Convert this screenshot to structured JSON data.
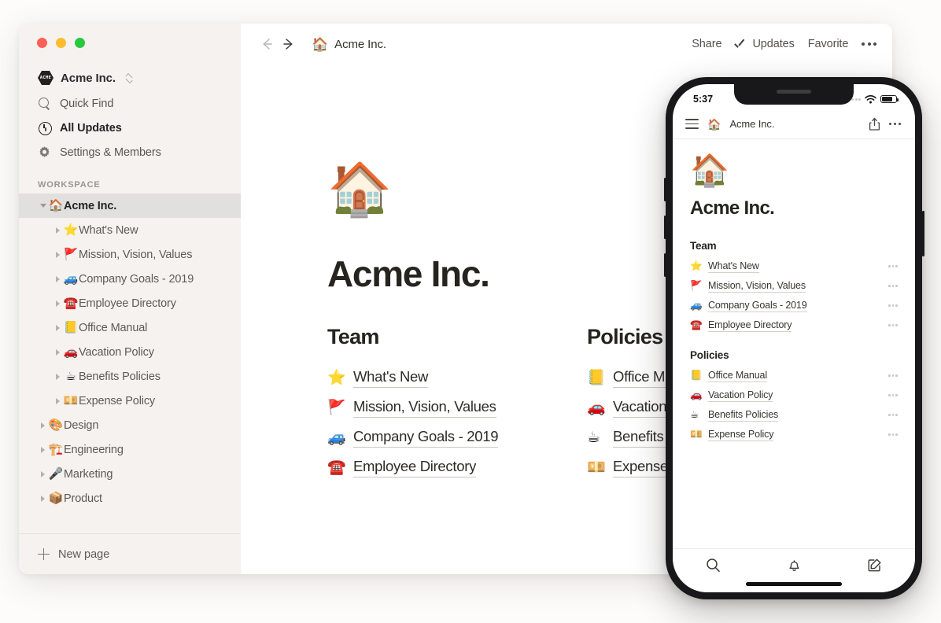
{
  "window": {
    "traffic_lights": [
      "close",
      "minimize",
      "maximize"
    ],
    "colors": {
      "red": "#ff5f57",
      "yellow": "#febc2e",
      "green": "#28c840",
      "sidebar_bg": "#f5f2ef",
      "selected_bg": "#e2e0de"
    }
  },
  "sidebar": {
    "workspace_switcher": {
      "logo_text": "ACME",
      "name": "Acme Inc."
    },
    "nav": [
      {
        "label": "Quick Find",
        "icon": "search-icon",
        "strong": false
      },
      {
        "label": "All Updates",
        "icon": "clock-icon",
        "strong": true
      },
      {
        "label": "Settings & Members",
        "icon": "gear-icon",
        "strong": false
      }
    ],
    "section_label": "WORKSPACE",
    "tree": [
      {
        "label": "Acme Inc.",
        "emoji": "🏠",
        "level": 1,
        "expanded": true,
        "selected": true,
        "bold": true
      },
      {
        "label": "What's New",
        "emoji": "⭐",
        "level": 2,
        "expanded": false,
        "selected": false,
        "bold": false
      },
      {
        "label": "Mission, Vision, Values",
        "emoji": "🚩",
        "level": 2,
        "expanded": false,
        "selected": false,
        "bold": false
      },
      {
        "label": "Company Goals - 2019",
        "emoji": "🚙",
        "level": 2,
        "expanded": false,
        "selected": false,
        "bold": false
      },
      {
        "label": "Employee Directory",
        "emoji": "☎️",
        "level": 2,
        "expanded": false,
        "selected": false,
        "bold": false
      },
      {
        "label": "Office Manual",
        "emoji": "📒",
        "level": 2,
        "expanded": false,
        "selected": false,
        "bold": false
      },
      {
        "label": "Vacation Policy",
        "emoji": "🚗",
        "level": 2,
        "expanded": false,
        "selected": false,
        "bold": false
      },
      {
        "label": "Benefits Policies",
        "emoji": "☕",
        "level": 2,
        "expanded": false,
        "selected": false,
        "bold": false
      },
      {
        "label": "Expense Policy",
        "emoji": "💴",
        "level": 2,
        "expanded": false,
        "selected": false,
        "bold": false
      },
      {
        "label": "Design",
        "emoji": "🎨",
        "level": 1,
        "expanded": false,
        "selected": false,
        "bold": false
      },
      {
        "label": "Engineering",
        "emoji": "🏗️",
        "level": 1,
        "expanded": false,
        "selected": false,
        "bold": false
      },
      {
        "label": "Marketing",
        "emoji": "🎤",
        "level": 1,
        "expanded": false,
        "selected": false,
        "bold": false
      },
      {
        "label": "Product",
        "emoji": "📦",
        "level": 1,
        "expanded": false,
        "selected": false,
        "bold": false
      }
    ],
    "footer": {
      "label": "New page",
      "icon": "plus-icon"
    }
  },
  "topbar": {
    "back_icon": "arrow-left-icon",
    "forward_icon": "arrow-right-icon",
    "breadcrumb": {
      "emoji": "🏠",
      "label": "Acme Inc."
    },
    "actions": [
      {
        "label": "Share",
        "icon": null
      },
      {
        "label": "Updates",
        "icon": "check-icon"
      },
      {
        "label": "Favorite",
        "icon": null
      }
    ],
    "more_icon": "ellipsis-icon"
  },
  "page": {
    "emoji": "🏠",
    "title": "Acme Inc.",
    "columns": [
      {
        "heading": "Team",
        "links": [
          {
            "emoji": "⭐",
            "label": "What's New"
          },
          {
            "emoji": "🚩",
            "label": "Mission, Vision, Values"
          },
          {
            "emoji": "🚙",
            "label": "Company Goals - 2019"
          },
          {
            "emoji": "☎️",
            "label": "Employee Directory"
          }
        ]
      },
      {
        "heading": "Policies",
        "links": [
          {
            "emoji": "📒",
            "label": "Office Manual"
          },
          {
            "emoji": "🚗",
            "label": "Vacation Policy"
          },
          {
            "emoji": "☕",
            "label": "Benefits Policies"
          },
          {
            "emoji": "💴",
            "label": "Expense Policy"
          }
        ]
      }
    ]
  },
  "phone": {
    "status": {
      "time": "5:37",
      "signal_icon": "signal-dots-icon",
      "wifi_icon": "wifi-icon",
      "battery_icon": "battery-icon"
    },
    "header": {
      "menu_icon": "hamburger-menu-icon",
      "emoji": "🏠",
      "title": "Acme Inc.",
      "share_icon": "share-icon",
      "more_icon": "ellipsis-icon"
    },
    "content": {
      "emoji": "🏠",
      "title": "Acme Inc.",
      "sections": [
        {
          "heading": "Team",
          "links": [
            {
              "emoji": "⭐",
              "label": "What's New"
            },
            {
              "emoji": "🚩",
              "label": "Mission, Vision, Values"
            },
            {
              "emoji": "🚙",
              "label": "Company Goals - 2019"
            },
            {
              "emoji": "☎️",
              "label": "Employee Directory"
            }
          ]
        },
        {
          "heading": "Policies",
          "links": [
            {
              "emoji": "📒",
              "label": "Office Manual"
            },
            {
              "emoji": "🚗",
              "label": "Vacation Policy"
            },
            {
              "emoji": "☕",
              "label": "Benefits Policies"
            },
            {
              "emoji": "💴",
              "label": "Expense Policy"
            }
          ]
        }
      ]
    },
    "tabbar": [
      {
        "icon": "search-icon"
      },
      {
        "icon": "bell-icon"
      },
      {
        "icon": "compose-icon"
      }
    ]
  }
}
